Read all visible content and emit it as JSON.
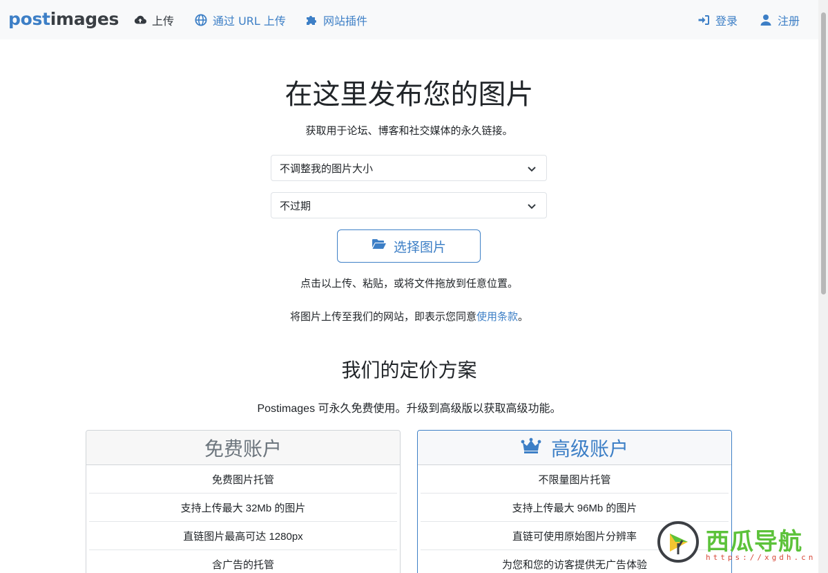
{
  "brand": {
    "part1": "post",
    "part2": "images"
  },
  "nav": {
    "upload": "上传",
    "upload_url": "通过 URL 上传",
    "plugins": "网站插件",
    "login": "登录",
    "register": "注册"
  },
  "hero": {
    "title": "在这里发布您的图片",
    "subtitle": "获取用于论坛、博客和社交媒体的永久链接。",
    "resize_select": "不调整我的图片大小",
    "expire_select": "不过期",
    "choose_button": "选择图片",
    "hint": "点击以上传、粘贴，或将文件拖放到任意位置。",
    "terms_prefix": "将图片上传至我们的网站，即表示您同意",
    "terms_link": "使用条款",
    "terms_suffix": "。"
  },
  "pricing": {
    "title": "我们的定价方案",
    "subtitle": "Postimages 可永久免费使用。升级到高级版以获取高级功能。",
    "free": {
      "title": "免费账户",
      "features": [
        "免费图片托管",
        "支持上传最大 32Mb 的图片",
        "直链图片最高可达 1280px",
        "含广告的托管"
      ]
    },
    "premium": {
      "title": "高级账户",
      "features": [
        "不限量图片托管",
        "支持上传最大 96Mb 的图片",
        "直链可使用原始图片分辨率",
        "为您和您的访客提供无广告体验"
      ]
    }
  },
  "watermark": {
    "text": "西瓜导航",
    "url": "https://xgdh.cn"
  },
  "colors": {
    "accent": "#3d7fc6",
    "navbar_bg": "#f8f9fa",
    "watermark_green": "#5cc23a"
  },
  "icons": {
    "upload": "cloud-upload-icon",
    "globe": "globe-icon",
    "plugin": "puzzle-icon",
    "login": "sign-in-icon",
    "user": "user-icon",
    "folder": "folder-open-icon",
    "crown": "crown-icon"
  }
}
